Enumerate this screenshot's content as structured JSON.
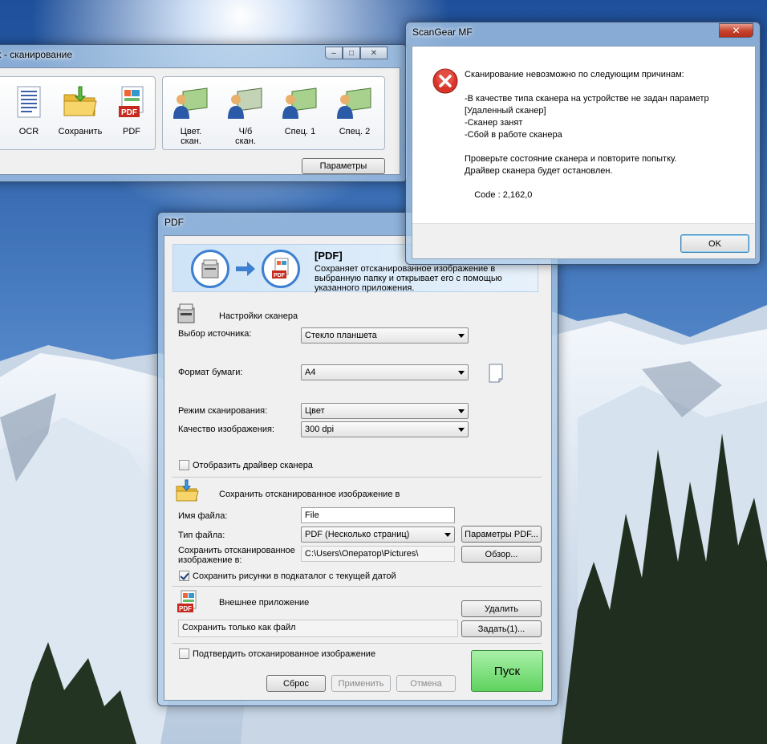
{
  "toolbox": {
    "title": "ох - сканирование",
    "tools_left": [
      {
        "label": "OCR",
        "icon": "ocr-document-icon"
      },
      {
        "label": "Сохранить",
        "icon": "folder-icon"
      },
      {
        "label": "PDF",
        "icon": "pdf-icon"
      }
    ],
    "tools_right": [
      {
        "label": "Цвет.\nскан.",
        "icon": "color-scan-icon"
      },
      {
        "label": "Ч/б\nскан.",
        "icon": "bw-scan-icon"
      },
      {
        "label": "Спец. 1",
        "icon": "custom1-scan-icon"
      },
      {
        "label": "Спец. 2",
        "icon": "custom2-scan-icon"
      }
    ],
    "params_button": "Параметры"
  },
  "pdf_dialog": {
    "title": "PDF",
    "banner": {
      "title": "[PDF]",
      "description": "Сохраняет отсканированное изображение в выбранную папку и открывает его с помощью указанного приложения."
    },
    "scanner_settings": {
      "heading": "Настройки сканера",
      "source_label": "Выбор источника:",
      "source_value": "Стекло планшета",
      "paper_label": "Формат бумаги:",
      "paper_value": "A4",
      "mode_label": "Режим сканирования:",
      "mode_value": "Цвет",
      "quality_label": "Качество изображения:",
      "quality_value": "300 dpi",
      "show_driver_label": "Отобразить драйвер сканера",
      "show_driver_checked": false
    },
    "save_settings": {
      "heading": "Сохранить отсканированное изображение в",
      "filename_label": "Имя файла:",
      "filename_value": "File",
      "filetype_label": "Тип файла:",
      "filetype_value": "PDF (Несколько страниц)",
      "pdf_params_button": "Параметры PDF...",
      "save_to_label": "Сохранить отсканированное\nизображение в:",
      "save_to_value": "C:\\Users\\Оператор\\Pictures\\",
      "browse_button": "Обзор...",
      "subfolder_label": "Сохранить рисунки в подкаталог с текущей датой",
      "subfolder_checked": true
    },
    "external_app": {
      "heading": "Внешнее приложение",
      "delete_button": "Удалить",
      "value": "Сохранить только как файл",
      "set_button": "Задать(1)..."
    },
    "confirm_label": "Подтвердить отсканированное изображение",
    "confirm_checked": false,
    "reset_button": "Сброс",
    "apply_button": "Применить",
    "cancel_button": "Отмена",
    "start_button": "Пуск"
  },
  "error_dialog": {
    "title": "ScanGear MF",
    "message": "Сканирование невозможно по следующим причинам:\n\n-В качестве типа сканера на устройстве не задан параметр\n[Удаленный сканер]\n-Сканер занят\n-Сбой в работе сканера\n\nПроверьте состояние сканера и повторите попытку.\nДрайвер сканера будет остановлен.\n\n    Code : 2,162,0",
    "ok_button": "OK"
  },
  "colors": {
    "error_red": "#d9352b",
    "start_green": "#6ad86a",
    "banner_blue": "#3d7fd0"
  }
}
